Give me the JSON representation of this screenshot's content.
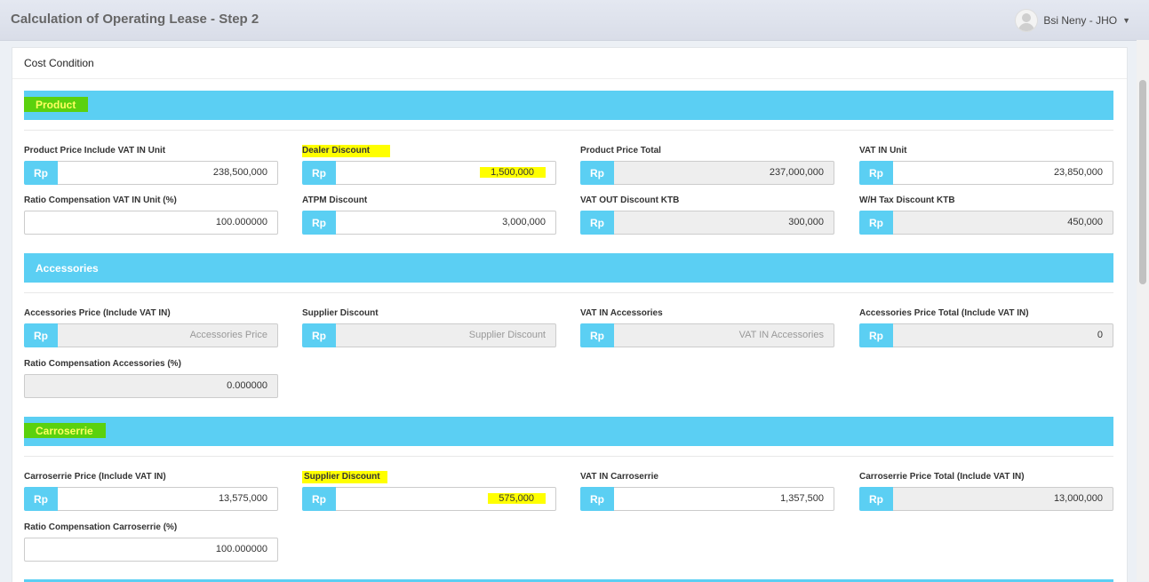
{
  "header": {
    "title": "Calculation of Operating Lease - Step 2",
    "user": "Bsi Neny - JHO"
  },
  "card": {
    "title": "Cost Condition"
  },
  "currency": "Rp",
  "product": {
    "title": "Product",
    "product_price": {
      "label": "Product Price Include VAT IN Unit",
      "value": "238,500,000"
    },
    "dealer_discount": {
      "label": "Dealer Discount",
      "value": "1,500,000"
    },
    "product_price_total": {
      "label": "Product Price Total",
      "value": "237,000,000"
    },
    "vat_in_unit": {
      "label": "VAT IN Unit",
      "value": "23,850,000"
    },
    "ratio_compensation": {
      "label": "Ratio Compensation VAT IN Unit (%)",
      "value": "100.000000"
    },
    "atpm_discount": {
      "label": "ATPM Discount",
      "value": "3,000,000"
    },
    "vat_out_discount": {
      "label": "VAT OUT Discount KTB",
      "value": "300,000"
    },
    "wh_tax_discount": {
      "label": "W/H Tax Discount KTB",
      "value": "450,000"
    }
  },
  "accessories": {
    "title": "Accessories",
    "price": {
      "label": "Accessories Price (Include VAT IN)",
      "placeholder": "Accessories Price"
    },
    "supplier_discount": {
      "label": "Supplier Discount",
      "placeholder": "Supplier Discount"
    },
    "vat_in": {
      "label": "VAT IN Accessories",
      "placeholder": "VAT IN Accessories"
    },
    "price_total": {
      "label": "Accessories Price Total (Include VAT IN)",
      "value": "0"
    },
    "ratio_compensation": {
      "label": "Ratio Compensation Accessories (%)",
      "value": "0.000000"
    }
  },
  "carroserrie": {
    "title": "Carroserrie",
    "price": {
      "label": "Carroserrie Price (Include VAT IN)",
      "value": "13,575,000"
    },
    "supplier_discount": {
      "label": "Supplier Discount",
      "value": "575,000"
    },
    "vat_in": {
      "label": "VAT IN Carroserrie",
      "value": "1,357,500"
    },
    "price_total": {
      "label": "Carroserrie Price Total (Include VAT IN)",
      "value": "13,000,000"
    },
    "ratio_compensation": {
      "label": "Ratio Compensation Carroserrie (%)",
      "value": "100.000000"
    }
  },
  "colors": {
    "section_bar": "#5bcff3",
    "highlight_yellow": "#ffff00",
    "highlight_green": "#5bd10e"
  }
}
